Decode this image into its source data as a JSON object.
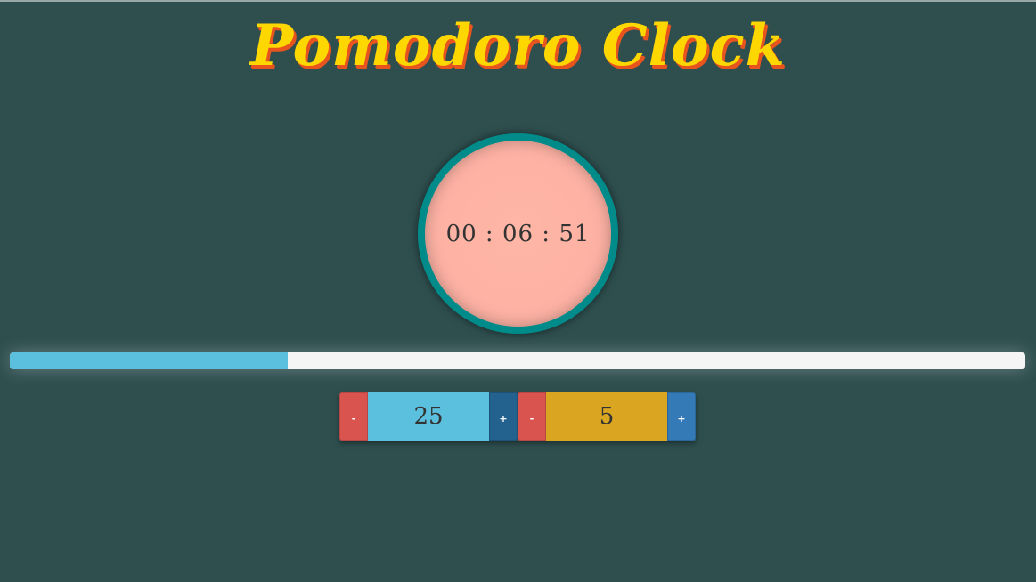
{
  "app": {
    "title": "Pomodoro Clock"
  },
  "clock": {
    "time": "00 : 06 : 51"
  },
  "progress": {
    "fraction": 0.274
  },
  "session": {
    "minus_label": "-",
    "value": "25",
    "plus_label": "+"
  },
  "break": {
    "minus_label": "-",
    "value": "5",
    "plus_label": "+"
  },
  "colors": {
    "background": "#2f4f4f",
    "title": "#ffd700",
    "title_shadow": "#e8541e",
    "clock_ring": "#008b8b",
    "clock_face": "#ffb6a6",
    "progress_fill": "#5bc0de",
    "progress_track": "#f5f5f5",
    "minus_button": "#d9534f",
    "plus_button": "#337ab7",
    "session_box": "#5bc0de",
    "break_box": "#daa520"
  }
}
